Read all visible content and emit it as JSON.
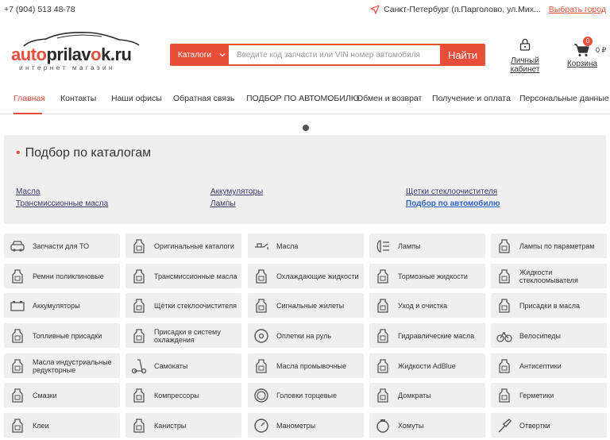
{
  "topbar": {
    "phone": "+7 (904) 513 48-78",
    "city": "Санкт-Петербург (п.Парголово, ул.Мих...",
    "change_city": "Выбрать город"
  },
  "logo": {
    "part1": "auto",
    "part2": "prilav",
    "part3": "o",
    "part4": "k.ru",
    "subtitle": "интернет магазин"
  },
  "search": {
    "catalog_label": "Каталоги",
    "placeholder": "Введите код запчасти или VIN номер автомобиля",
    "button_label": "Найти"
  },
  "account": {
    "label": "Личный кабинет"
  },
  "cart": {
    "label": "Корзина",
    "count": "0",
    "sum": "0 ₽"
  },
  "nav": [
    {
      "label": "Главная",
      "active": true
    },
    {
      "label": "Контакты"
    },
    {
      "label": "Наши офисы"
    },
    {
      "label": "Обратная связь"
    },
    {
      "label": "ПОДБОР ПО АВТОМОБИЛЮ"
    },
    {
      "label": "Обмен и возврат"
    },
    {
      "label": "Получение и оплата"
    },
    {
      "label": "Персональные данные"
    }
  ],
  "catalog_panel": {
    "title": "Подбор по каталогам",
    "links": [
      "Масла",
      "Трансмиссионные масла",
      "Аккумуляторы",
      "Лампы",
      "Щетки стеклоочистителя",
      "Подбор по автомобилю"
    ]
  },
  "categories": [
    [
      "Запчасти для ТО",
      "car-icon"
    ],
    [
      "Оригинальные каталоги",
      "catalog-icon"
    ],
    [
      "Масла",
      "oil-can-icon"
    ],
    [
      "Лампы",
      "lamp-icon"
    ],
    [
      "Лампы по параметрам",
      "lamp-params-icon"
    ],
    [
      "Ремни поликлиновые",
      "belt-icon"
    ],
    [
      "Трансмиссионные масла",
      "transmission-oil-icon"
    ],
    [
      "Охлаждающие жидкости",
      "coolant-icon"
    ],
    [
      "Тормозные жидкости",
      "brake-fluid-icon"
    ],
    [
      "Жидкости стеклоомывателя",
      "washer-fluid-icon"
    ],
    [
      "Аккумуляторы",
      "battery-icon"
    ],
    [
      "Щётки стеклоочистителя",
      "wiper-icon"
    ],
    [
      "Сигнальные жилеты",
      "vest-icon"
    ],
    [
      "Уход и очистка",
      "cleaning-icon"
    ],
    [
      "Присадки в масла",
      "oil-additive-icon"
    ],
    [
      "Топливные присадки",
      "fuel-additive-icon"
    ],
    [
      "Присадки в систему охлаждения",
      "cooling-additive-icon"
    ],
    [
      "Оплетки на руль",
      "steering-wheel-icon"
    ],
    [
      "Гидравлические масла",
      "hydraulic-oil-icon"
    ],
    [
      "Велосипеды",
      "bicycle-icon"
    ],
    [
      "Масла индустриальные редукторные",
      "industrial-oil-icon"
    ],
    [
      "Самокаты",
      "scooter-icon"
    ],
    [
      "Масла промывочные",
      "flushing-oil-icon"
    ],
    [
      "Жидкости AdBlue",
      "adblue-icon"
    ],
    [
      "Антисептики",
      "antiseptic-icon"
    ],
    [
      "Смазки",
      "grease-icon"
    ],
    [
      "Компрессоры",
      "compressor-icon"
    ],
    [
      "Головки торцевые",
      "socket-icon"
    ],
    [
      "Домкраты",
      "jack-icon"
    ],
    [
      "Герметики",
      "sealant-icon"
    ],
    [
      "Клеи",
      "glue-icon"
    ],
    [
      "Канистры",
      "canister-icon"
    ],
    [
      "Манометры",
      "gauge-icon"
    ],
    [
      "Хомуты",
      "clamp-icon"
    ],
    [
      "Отвертки",
      "screwdriver-icon"
    ]
  ],
  "colors": {
    "accent": "#e94e3a",
    "link": "#2f63c8",
    "tile_bg": "#efefef"
  }
}
